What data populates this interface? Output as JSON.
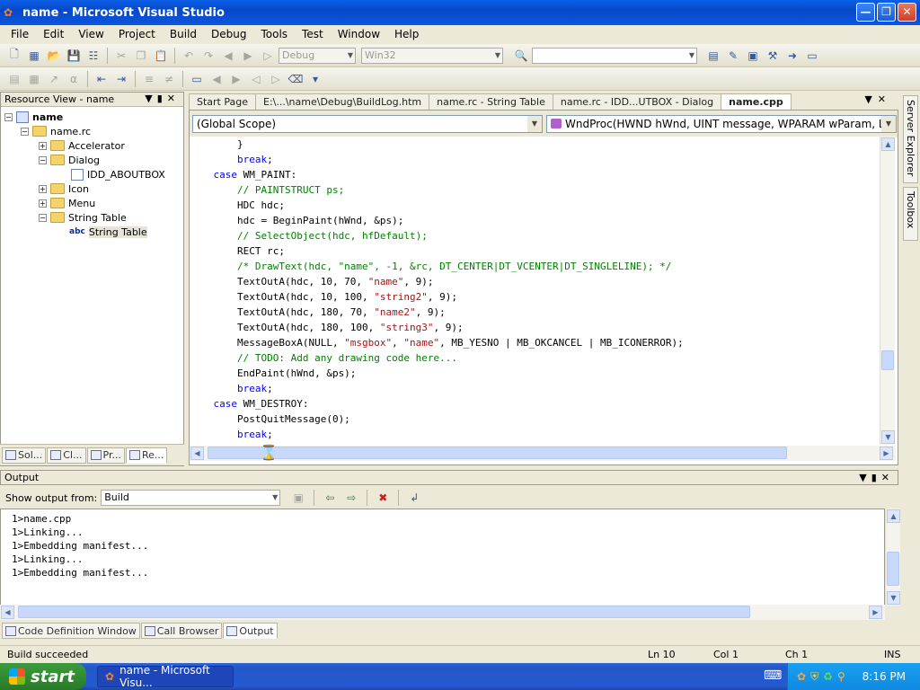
{
  "window": {
    "title": "name - Microsoft Visual Studio",
    "app_icon": "vs-app-icon"
  },
  "menu": [
    "File",
    "Edit",
    "View",
    "Project",
    "Build",
    "Debug",
    "Tools",
    "Test",
    "Window",
    "Help"
  ],
  "toolbar": {
    "config_value": "Debug",
    "platform_value": "Win32",
    "find_value": ""
  },
  "resource_view": {
    "title": "Resource View - name",
    "tree": [
      {
        "label": "name",
        "level": 0,
        "type": "project",
        "expanded": true
      },
      {
        "label": "name.rc",
        "level": 1,
        "type": "folder",
        "expanded": true
      },
      {
        "label": "Accelerator",
        "level": 2,
        "type": "folder",
        "expanded": false
      },
      {
        "label": "Dialog",
        "level": 2,
        "type": "folder",
        "expanded": true
      },
      {
        "label": "IDD_ABOUTBOX",
        "level": 3,
        "type": "dialog"
      },
      {
        "label": "Icon",
        "level": 2,
        "type": "folder",
        "expanded": false
      },
      {
        "label": "Menu",
        "level": 2,
        "type": "folder",
        "expanded": false
      },
      {
        "label": "String Table",
        "level": 2,
        "type": "folder",
        "expanded": true
      },
      {
        "label": "String Table",
        "level": 3,
        "type": "stringtable",
        "selected": true
      }
    ],
    "bottom_tabs": [
      "Sol...",
      "Cl...",
      "Pr...",
      "Re..."
    ]
  },
  "doc_tabs": [
    {
      "label": "Start Page",
      "active": false
    },
    {
      "label": "E:\\...\\name\\Debug\\BuildLog.htm",
      "active": false
    },
    {
      "label": "name.rc - String Table",
      "active": false
    },
    {
      "label": "name.rc - IDD...UTBOX - Dialog",
      "active": false
    },
    {
      "label": "name.cpp",
      "active": true
    }
  ],
  "editor": {
    "scope": "(Global Scope)",
    "function": "WndProc(HWND hWnd, UINT message, WPARAM wParam, LPARAM lParam)",
    "lines": [
      [
        [
          "plain",
          "        }"
        ]
      ],
      [
        [
          "kw",
          "        break"
        ],
        [
          "plain",
          ";"
        ]
      ],
      [
        [
          "kw",
          "    case "
        ],
        [
          "plain",
          "WM_PAINT:"
        ]
      ],
      [
        [
          "cm",
          "        // PAINTSTRUCT ps;"
        ]
      ],
      [
        [
          "plain",
          "        HDC hdc;"
        ]
      ],
      [
        [
          "plain",
          "        hdc = BeginPaint(hWnd, &ps);"
        ]
      ],
      [
        [
          "cm",
          "        // SelectObject(hdc, hfDefault);"
        ]
      ],
      [
        [
          "plain",
          "        RECT rc;"
        ]
      ],
      [
        [
          "cm",
          "        /* DrawText(hdc, \"name\", -1, &rc, DT_CENTER|DT_VCENTER|DT_SINGLELINE); */"
        ]
      ],
      [
        [
          "plain",
          "        TextOutA(hdc, 10, 70, "
        ],
        [
          "st",
          "\"name\""
        ],
        [
          "plain",
          ", 9);"
        ]
      ],
      [
        [
          "plain",
          "        TextOutA(hdc, 10, 100, "
        ],
        [
          "st",
          "\"string2\""
        ],
        [
          "plain",
          ", 9);"
        ]
      ],
      [
        [
          "plain",
          "        TextOutA(hdc, 180, 70, "
        ],
        [
          "st",
          "\"name2\""
        ],
        [
          "plain",
          ", 9);"
        ]
      ],
      [
        [
          "plain",
          "        TextOutA(hdc, 180, 100, "
        ],
        [
          "st",
          "\"string3\""
        ],
        [
          "plain",
          ", 9);"
        ]
      ],
      [
        [
          "plain",
          "        MessageBoxA(NULL, "
        ],
        [
          "st",
          "\"msgbox\""
        ],
        [
          "plain",
          ", "
        ],
        [
          "st",
          "\"name\""
        ],
        [
          "plain",
          ", MB_YESNO | MB_OKCANCEL | MB_ICONERROR);"
        ]
      ],
      [
        [
          "cm",
          "        // TODO: Add any drawing code here..."
        ]
      ],
      [
        [
          "plain",
          "        EndPaint(hWnd, &ps);"
        ]
      ],
      [
        [
          "kw",
          "        break"
        ],
        [
          "plain",
          ";"
        ]
      ],
      [
        [
          "kw",
          "    case "
        ],
        [
          "plain",
          "WM_DESTROY:"
        ]
      ],
      [
        [
          "plain",
          "        PostQuitMessage(0);"
        ]
      ],
      [
        [
          "kw",
          "        break"
        ],
        [
          "plain",
          ";"
        ]
      ]
    ]
  },
  "output": {
    "title": "Output",
    "show_from_label": "Show output from:",
    "show_from_value": "Build",
    "lines": [
      "1>name.cpp",
      "1>Linking...",
      "1>Embedding manifest...",
      "1>Linking...",
      "1>Embedding manifest..."
    ],
    "tabs": [
      "Code Definition Window",
      "Call Browser",
      "Output"
    ]
  },
  "side_tabs": [
    "Server Explorer",
    "Toolbox"
  ],
  "status": {
    "message": "Build succeeded",
    "ln": "Ln 10",
    "col": "Col 1",
    "ch": "Ch 1",
    "mode": "INS"
  },
  "taskbar": {
    "start_label": "start",
    "app_label": "name - Microsoft Visu...",
    "clock": "8:16 PM"
  }
}
